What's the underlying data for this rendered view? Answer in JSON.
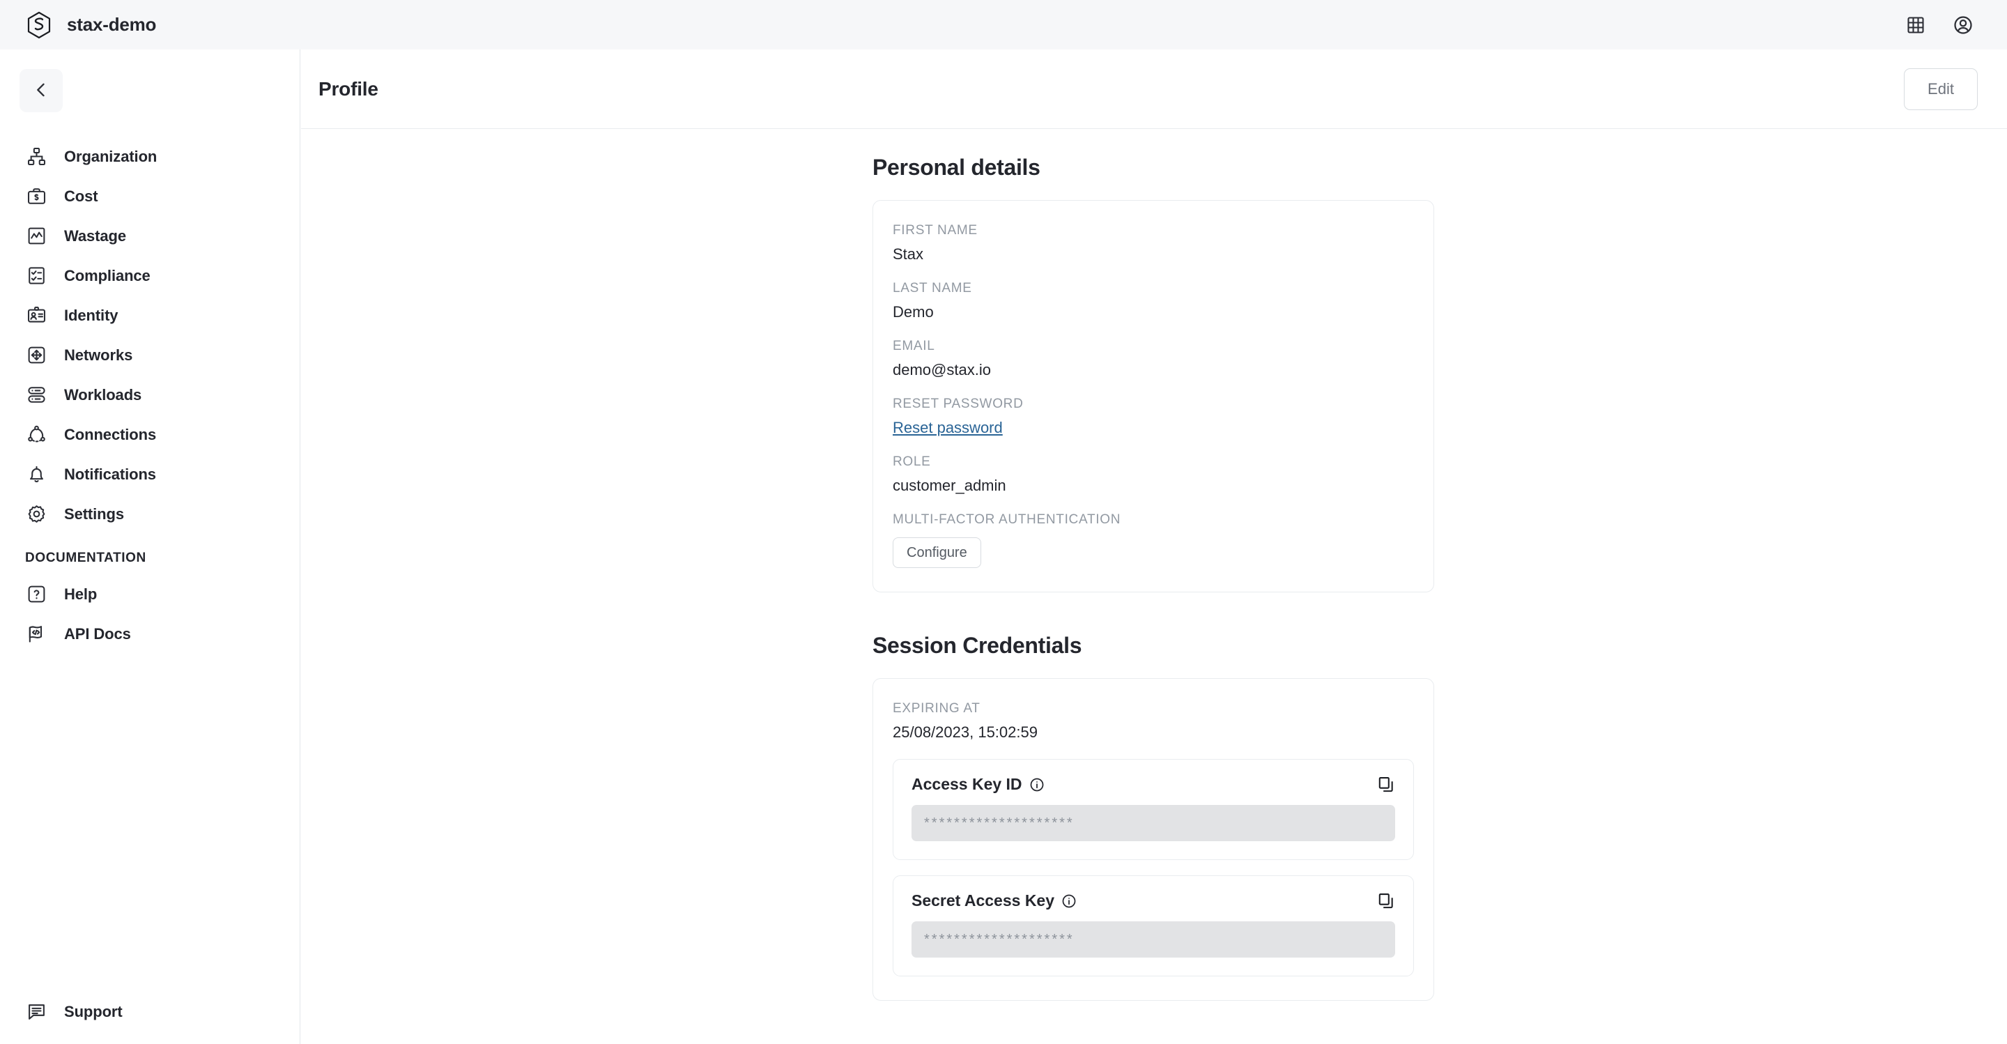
{
  "topbar": {
    "brand_name": "stax-demo",
    "logo_icon": "stax-hexagon-logo",
    "apps_icon": "grid-apps-icon",
    "account_icon": "user-account-icon"
  },
  "sidebar": {
    "collapse_icon": "chevron-left-icon",
    "items": [
      {
        "label": "Organization",
        "icon": "org-chart-icon"
      },
      {
        "label": "Cost",
        "icon": "briefcase-dollar-icon"
      },
      {
        "label": "Wastage",
        "icon": "chart-line-box-icon"
      },
      {
        "label": "Compliance",
        "icon": "checklist-icon"
      },
      {
        "label": "Identity",
        "icon": "id-card-icon"
      },
      {
        "label": "Networks",
        "icon": "arrows-move-box-icon"
      },
      {
        "label": "Workloads",
        "icon": "server-stack-icon"
      },
      {
        "label": "Connections",
        "icon": "network-nodes-icon"
      },
      {
        "label": "Notifications",
        "icon": "bell-icon"
      },
      {
        "label": "Settings",
        "icon": "gear-icon"
      }
    ],
    "documentation_heading": "DOCUMENTATION",
    "documentation_items": [
      {
        "label": "Help",
        "icon": "question-mark-box-icon"
      },
      {
        "label": "API Docs",
        "icon": "code-flag-icon"
      }
    ],
    "support": {
      "label": "Support",
      "icon": "chat-bubble-icon"
    }
  },
  "header": {
    "title": "Profile",
    "edit_label": "Edit"
  },
  "personal_details": {
    "heading": "Personal details",
    "first_name_label": "FIRST NAME",
    "first_name_value": "Stax",
    "last_name_label": "LAST NAME",
    "last_name_value": "Demo",
    "email_label": "EMAIL",
    "email_value": "demo@stax.io",
    "reset_password_label": "RESET PASSWORD",
    "reset_password_link": "Reset password",
    "role_label": "ROLE",
    "role_value": "customer_admin",
    "mfa_label": "MULTI-FACTOR AUTHENTICATION",
    "mfa_button": "Configure"
  },
  "session_credentials": {
    "heading": "Session Credentials",
    "expiring_at_label": "EXPIRING AT",
    "expiring_at_value": "25/08/2023, 15:02:59",
    "access_key": {
      "title": "Access Key ID",
      "info_icon": "info-circle-icon",
      "copy_icon": "copy-icon",
      "masked_value": "********************"
    },
    "secret_key": {
      "title": "Secret Access Key",
      "info_icon": "info-circle-icon",
      "copy_icon": "copy-icon",
      "masked_value": "********************"
    }
  },
  "colors": {
    "topbar_bg": "#f6f7f9",
    "text_primary": "#24262d",
    "text_muted": "#9299a2",
    "link": "#2a6496",
    "border": "#e9ecef",
    "masked_field_bg": "#e2e3e5"
  }
}
